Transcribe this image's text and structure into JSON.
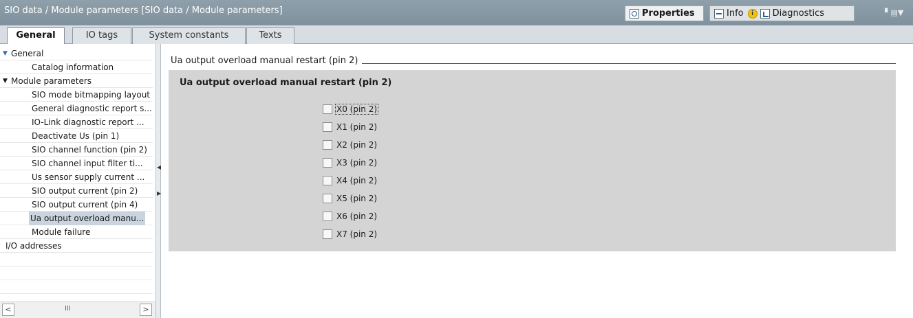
{
  "window": {
    "title": "SIO data / Module parameters [SIO data / Module parameters]",
    "right_tabs": [
      {
        "label": "Properties"
      },
      {
        "label": "Info"
      },
      {
        "label": "Diagnostics"
      }
    ],
    "info_badge": "i",
    "window_controls": "▘▤▼"
  },
  "tabs": [
    {
      "label": "General"
    },
    {
      "label": "IO tags"
    },
    {
      "label": "System constants"
    },
    {
      "label": "Texts"
    }
  ],
  "nav": {
    "items": [
      {
        "label": "General"
      },
      {
        "label": "Catalog information"
      },
      {
        "label": "Module parameters"
      },
      {
        "label": "SIO mode bitmapping layout"
      },
      {
        "label": "General diagnostic report s..."
      },
      {
        "label": "IO-Link diagnostic report ..."
      },
      {
        "label": "Deactivate Us (pin 1)"
      },
      {
        "label": "SIO channel function (pin 2)"
      },
      {
        "label": "SIO channel input filter ti..."
      },
      {
        "label": "Us sensor supply current ..."
      },
      {
        "label": "SIO output current (pin 2)"
      },
      {
        "label": "SIO output current (pin 4)"
      },
      {
        "label": "Ua output overload manu..."
      },
      {
        "label": "Module failure"
      },
      {
        "label": "I/O addresses"
      }
    ],
    "scroll_left": "<",
    "scroll_right": ">",
    "scroll_grip": "III"
  },
  "content": {
    "section_title": "Ua output overload manual restart (pin 2)",
    "group_title": "Ua output overload manual restart (pin 2)",
    "checkboxes": [
      {
        "label": "X0 (pin 2)",
        "checked": false
      },
      {
        "label": "X1 (pin 2)",
        "checked": false
      },
      {
        "label": "X2 (pin 2)",
        "checked": false
      },
      {
        "label": "X3 (pin 2)",
        "checked": false
      },
      {
        "label": "X4 (pin 2)",
        "checked": false
      },
      {
        "label": "X5 (pin 2)",
        "checked": false
      },
      {
        "label": "X6 (pin 2)",
        "checked": false
      },
      {
        "label": "X7 (pin 2)",
        "checked": false
      }
    ]
  }
}
